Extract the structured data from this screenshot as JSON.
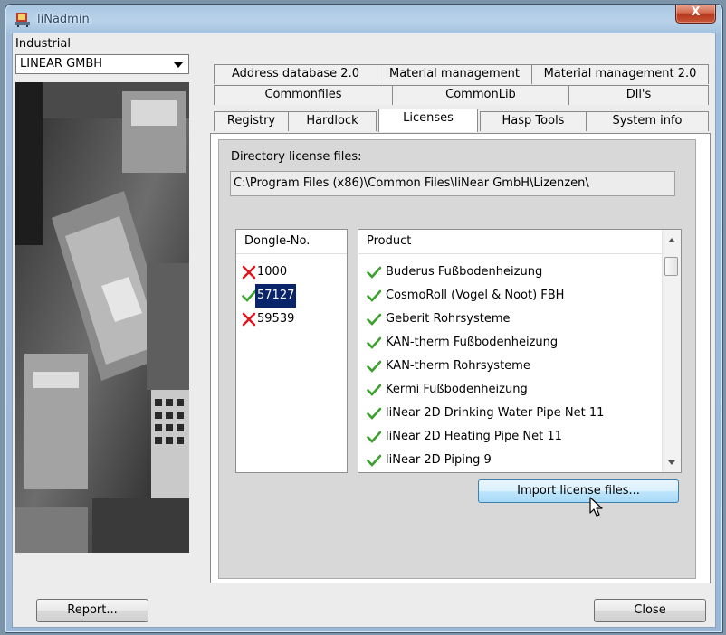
{
  "window": {
    "title": "liNadmin",
    "close_glyph": "X"
  },
  "left": {
    "industry_label": "Industrial",
    "company_select": {
      "value": "LINEAR GMBH"
    }
  },
  "tabs": {
    "row1": [
      "Address database 2.0",
      "Material management",
      "Material management 2.0"
    ],
    "row2": [
      "Commonfiles",
      "CommonLib",
      "Dll's"
    ],
    "row3": [
      "Registry",
      "Hardlock",
      "Licenses",
      "Hasp Tools",
      "System info"
    ],
    "active": "Licenses"
  },
  "licenses": {
    "dir_label": "Directory license files:",
    "dir_path": "C:\\Program Files (x86)\\Common Files\\liNear GmbH\\Lizenzen\\",
    "dongle_header": "Dongle-No.",
    "dongles": [
      {
        "id": "1000",
        "status": "invalid"
      },
      {
        "id": "57127",
        "status": "valid",
        "selected": true
      },
      {
        "id": "59539",
        "status": "invalid"
      }
    ],
    "product_header": "Product",
    "products": [
      "Buderus Fußbodenheizung",
      "CosmoRoll (Vogel & Noot) FBH",
      "Geberit Rohrsysteme",
      "KAN-therm Fußbodenheizung",
      "KAN-therm Rohrsysteme",
      "Kermi Fußbodenheizung",
      "liNear 2D Drinking Water Pipe Net 11",
      "liNear 2D Heating Pipe Net 11",
      "liNear 2D Piping 9"
    ],
    "import_button": "Import license files..."
  },
  "footer": {
    "report_button": "Report...",
    "close_button": "Close"
  },
  "colors": {
    "check": "#3aa12c",
    "cross": "#e0141e",
    "selection": "#0a246a"
  }
}
